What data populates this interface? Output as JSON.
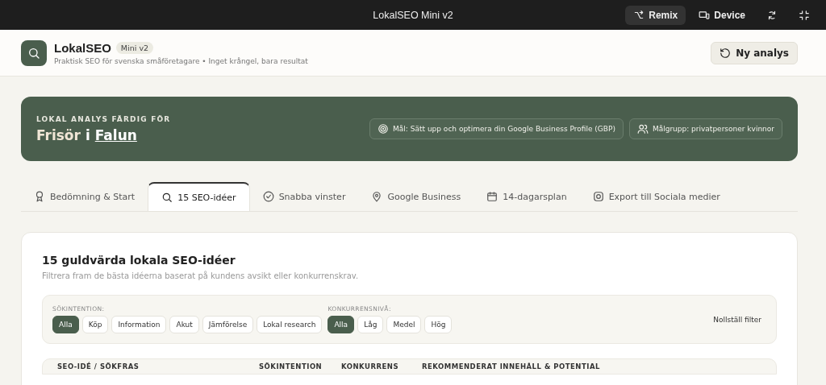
{
  "window": {
    "title": "LokalSEO Mini v2",
    "actions": [
      {
        "kind": "remix",
        "label": "Remix"
      },
      {
        "kind": "device",
        "label": "Device"
      },
      {
        "kind": "refresh"
      },
      {
        "kind": "fullscreen"
      }
    ]
  },
  "app_header": {
    "name": "LokalSEO",
    "badge": "Mini v2",
    "tagline": "Praktisk SEO för svenska småföretagare • Inget krångel, bara resultat",
    "button": "Ny analys"
  },
  "banner": {
    "eyebrow": "LOKAL ANALYS FÄRDIG FÖR",
    "business": "Frisör",
    "connector": "i",
    "city": "Falun",
    "chips": [
      {
        "kind": "goal",
        "label": "Mål: Sätt upp och optimera din Google Business Profile (GBP)"
      },
      {
        "kind": "audience",
        "label": "Målgrupp: privatpersoner kvinnor"
      }
    ]
  },
  "tabs": [
    {
      "kind": "award",
      "label": "Bedömning & Start",
      "selected": false
    },
    {
      "kind": "search",
      "label": "15 SEO-idéer",
      "selected": true
    },
    {
      "kind": "check",
      "label": "Snabba vinster",
      "selected": false
    },
    {
      "kind": "pin",
      "label": "Google Business",
      "selected": false
    },
    {
      "kind": "calendar",
      "label": "14-dagarsplan",
      "selected": false
    },
    {
      "kind": "camera",
      "label": "Export till Sociala medier",
      "selected": false
    }
  ],
  "section": {
    "title": "15 guldvärda lokala SEO-idéer",
    "subtitle": "Filtrera fram de bästa idéerna baserat på kundens avsikt eller konkurrenskrav.",
    "filters": [
      {
        "label": "SÖKINTENTION:",
        "options": [
          {
            "label": "Alla",
            "selected": true
          },
          {
            "label": "Köp",
            "selected": false
          },
          {
            "label": "Information",
            "selected": false
          },
          {
            "label": "Akut",
            "selected": false
          },
          {
            "label": "Jämförelse",
            "selected": false
          },
          {
            "label": "Lokal research",
            "selected": false
          }
        ]
      },
      {
        "label": "KONKURRENSNIVÅ:",
        "options": [
          {
            "label": "Alla",
            "selected": true
          },
          {
            "label": "Låg",
            "selected": false
          },
          {
            "label": "Medel",
            "selected": false
          },
          {
            "label": "Hög",
            "selected": false
          }
        ]
      }
    ],
    "reset": "Nollställ filter",
    "table": {
      "columns": [
        "SEO-IDÉ / SÖKFRAS",
        "SÖKINTENTION",
        "KONKURRENS",
        "REKOMMENDERAT INNEHÅLL & POTENTIAL"
      ]
    }
  }
}
